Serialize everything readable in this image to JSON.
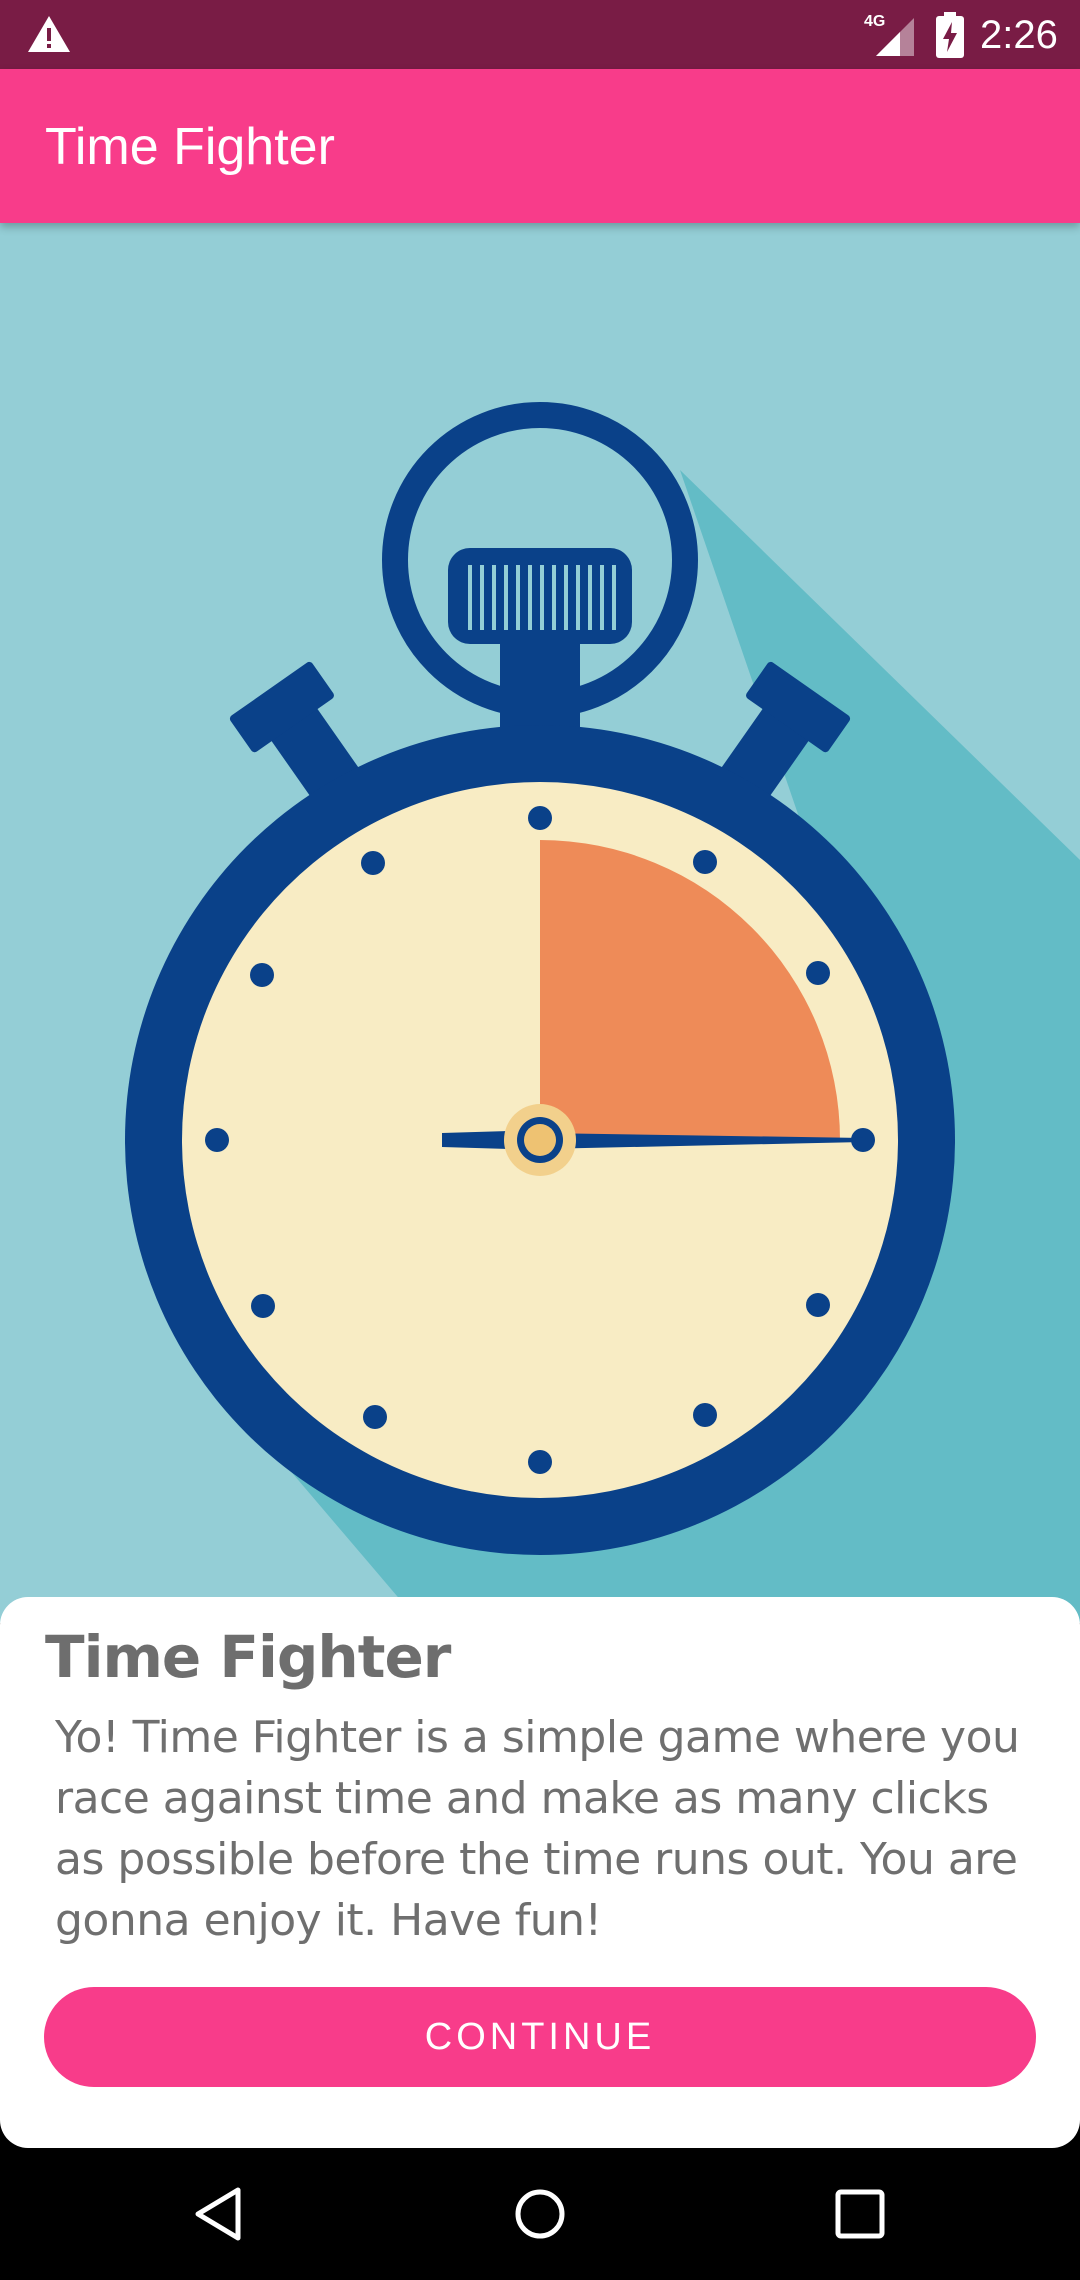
{
  "status_bar": {
    "time": "2:26",
    "network": "4G",
    "icons": [
      "warning-icon",
      "signal-icon",
      "battery-charging-icon"
    ]
  },
  "app_bar": {
    "title": "Time Fighter"
  },
  "hero": {
    "illustration": "stopwatch-icon"
  },
  "card": {
    "title": "Time Fighter",
    "body": "Yo! Time Fighter is a simple game where you race against time and make as many clicks as possible before the time runs out. You are gonna enjoy it. Have fun!",
    "continue_label": "CONTINUE"
  },
  "nav_bar": {
    "icons": [
      "back-icon",
      "home-icon",
      "recents-icon"
    ]
  },
  "colors": {
    "status_bar": "#791c45",
    "accent": "#f83c8a",
    "hero_bg": "#94ced6",
    "stopwatch_frame": "#0a4189",
    "dial_face": "#f8ecc4",
    "elapsed_wedge": "#ee8b58"
  }
}
